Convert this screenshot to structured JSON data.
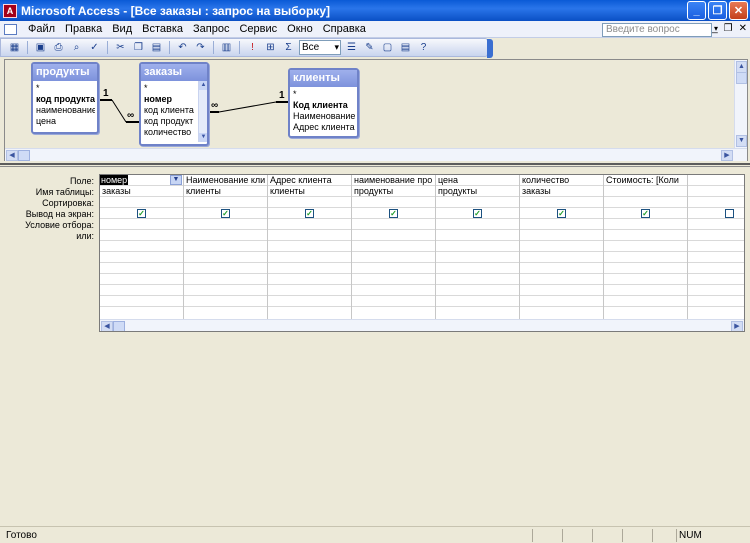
{
  "window": {
    "title": "Microsoft Access - [Все заказы : запрос на выборку]"
  },
  "menu": {
    "items": [
      "Файл",
      "Правка",
      "Вид",
      "Вставка",
      "Запрос",
      "Сервис",
      "Окно",
      "Справка"
    ],
    "help_placeholder": "Введите вопрос"
  },
  "toolbar": {
    "query_type_value": "Все"
  },
  "tables": [
    {
      "name": "продукты",
      "fields": [
        "*",
        "код продукта",
        "наименование пр",
        "цена"
      ]
    },
    {
      "name": "заказы",
      "fields": [
        "*",
        "номер",
        "код клиента",
        "код продукт",
        "количество"
      ]
    },
    {
      "name": "клиенты",
      "fields": [
        "*",
        "Код клиента",
        "Наименование к",
        "Адрес клиента"
      ]
    }
  ],
  "relationships": [
    {
      "left": "1",
      "right": "∞"
    },
    {
      "left": "∞",
      "right": "1"
    }
  ],
  "grid": {
    "row_labels": [
      "Поле:",
      "Имя таблицы:",
      "Сортировка:",
      "Вывод на экран:",
      "Условие отбора:",
      "или:"
    ],
    "columns": [
      {
        "field": "номер",
        "table": "заказы",
        "show": true
      },
      {
        "field": "Наименование кли",
        "table": "клиенты",
        "show": true
      },
      {
        "field": "Адрес клиента",
        "table": "клиенты",
        "show": true
      },
      {
        "field": "наименование про",
        "table": "продукты",
        "show": true
      },
      {
        "field": "цена",
        "table": "продукты",
        "show": true
      },
      {
        "field": "количество",
        "table": "заказы",
        "show": true
      },
      {
        "field": "Стоимость: [Коли",
        "table": "",
        "show": true
      },
      {
        "field": "",
        "table": "",
        "show": false
      }
    ]
  },
  "status": {
    "text": "Готово",
    "num": "NUM"
  }
}
